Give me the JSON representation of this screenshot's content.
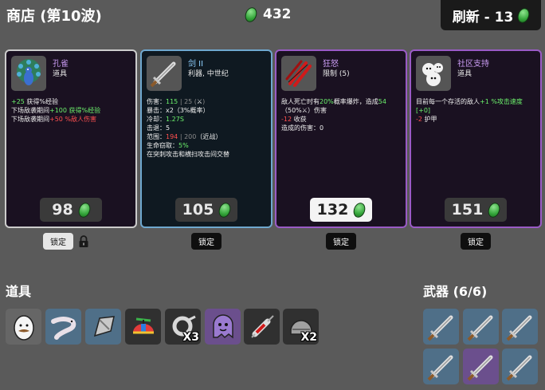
{
  "header": {
    "title": "商店 (第10波)",
    "gold_amount": "432",
    "gold_icon": "green-material-icon",
    "reroll_label": "刷新 - 13"
  },
  "cards": [
    {
      "name": "孔雀",
      "type": "道具",
      "icon": "peacock-icon",
      "desc": [
        [
          {
            "t": "+25",
            "c": "g"
          },
          {
            "t": " 获得%经验"
          }
        ],
        [
          {
            "t": "下场敌袭期间"
          },
          {
            "t": "+100",
            "c": "g"
          },
          {
            "t": " 获得%经验",
            "c": "g"
          }
        ],
        [
          {
            "t": "下场敌袭期间"
          },
          {
            "t": "+50",
            "c": "r"
          },
          {
            "t": " %敌人伤害",
            "c": "r"
          }
        ]
      ],
      "price": "98",
      "lock_label": "锁定",
      "rarity_color": "#cccccc"
    },
    {
      "name": "剑 II",
      "type": "利器, 中世纪",
      "icon": "sword-icon",
      "desc": [
        [
          {
            "t": "伤害："
          },
          {
            "t": "115",
            "c": "g"
          },
          {
            "t": " | 25 (",
            "c": "dim"
          },
          {
            "t": "⚔"
          },
          {
            "t": ")",
            "c": "dim"
          }
        ],
        [
          {
            "t": "暴击：x2（3%概率）"
          }
        ],
        [
          {
            "t": "冷却："
          },
          {
            "t": "1.27S",
            "c": "g"
          }
        ],
        [
          {
            "t": "击退：5"
          }
        ],
        [
          {
            "t": "范围："
          },
          {
            "t": "194",
            "c": "r"
          },
          {
            "t": " | 200",
            "c": "dim"
          },
          {
            "t": "（近战）"
          }
        ],
        [
          {
            "t": "生命窃取："
          },
          {
            "t": "5%",
            "c": "g"
          }
        ],
        [
          {
            "t": "在突刺攻击和横扫攻击间交替"
          }
        ]
      ],
      "price": "105",
      "lock_label": "锁定",
      "rarity_color": "#6fa8cf"
    },
    {
      "name": "狂怒",
      "type": "限制 (5)",
      "icon": "rage-claw-icon",
      "desc": [
        [
          {
            "t": "敌人死亡时有"
          },
          {
            "t": "20%",
            "c": "g"
          },
          {
            "t": "概率爆炸，造成"
          },
          {
            "t": "54",
            "c": "g"
          }
        ],
        [
          {
            "t": "（50%"
          },
          {
            "t": "⚔"
          },
          {
            "t": "）伤害"
          }
        ],
        [
          {
            "t": "-12",
            "c": "r"
          },
          {
            "t": " 收获"
          }
        ],
        [
          {
            "t": "造成的伤害：0"
          }
        ]
      ],
      "price": "132",
      "lock_label": "锁定",
      "rarity_color": "#9a5bc6"
    },
    {
      "name": "社区支持",
      "type": "道具",
      "icon": "community-blobs-icon",
      "desc": [
        [
          {
            "t": "目前每一个存活的敌人"
          },
          {
            "t": "+1 %攻击速度",
            "c": "g"
          }
        ],
        [
          {
            "t": "[+0]",
            "c": "g"
          }
        ],
        [
          {
            "t": "-2",
            "c": "r"
          },
          {
            "t": " 护甲"
          }
        ]
      ],
      "price": "151",
      "lock_label": "锁定",
      "rarity_color": "#9a5bc6"
    }
  ],
  "items_section": {
    "title": "道具",
    "items": [
      {
        "icon": "egg-mustache-icon",
        "rarity": "white",
        "qty": ""
      },
      {
        "icon": "worm-icon",
        "rarity": "blue",
        "qty": ""
      },
      {
        "icon": "metal-blade-icon",
        "rarity": "blue",
        "qty": ""
      },
      {
        "icon": "propeller-hat-icon",
        "rarity": "gray",
        "qty": ""
      },
      {
        "icon": "scythe-ring-icon",
        "rarity": "gray",
        "qty": "X3"
      },
      {
        "icon": "purple-ghost-icon",
        "rarity": "purple",
        "qty": ""
      },
      {
        "icon": "syringe-icon",
        "rarity": "gray",
        "qty": ""
      },
      {
        "icon": "helmet-icon",
        "rarity": "gray",
        "qty": "X2"
      }
    ]
  },
  "weapons_section": {
    "title": "武器 (6/6)",
    "weapons": [
      {
        "icon": "sword-icon",
        "rarity": "blue"
      },
      {
        "icon": "sword-icon",
        "rarity": "blue"
      },
      {
        "icon": "sword-icon",
        "rarity": "blue"
      },
      {
        "icon": "sword-icon",
        "rarity": "blue"
      },
      {
        "icon": "sword-icon",
        "rarity": "purple"
      },
      {
        "icon": "sword-icon",
        "rarity": "blue"
      }
    ]
  }
}
